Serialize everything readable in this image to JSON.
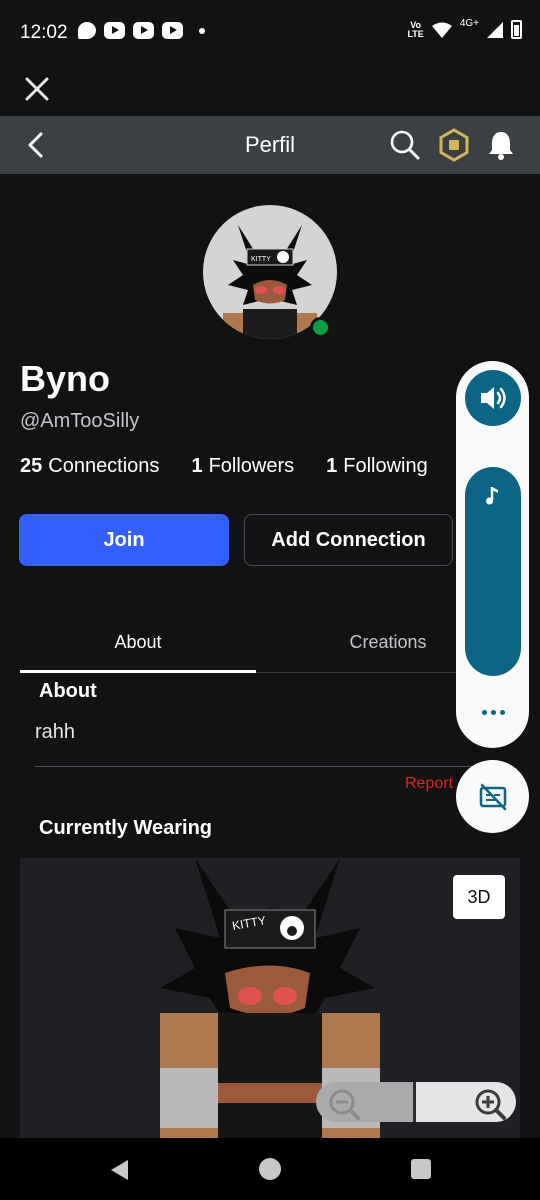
{
  "status_bar": {
    "time": "12:02",
    "volte": "Vo\nLTE",
    "network": "4G+"
  },
  "header": {
    "title": "Perfil"
  },
  "profile": {
    "display_name": "Byno",
    "username": "@AmTooSilly",
    "online": true,
    "hat_text": "KITTY",
    "stats": [
      {
        "count": "25",
        "label": "Connections"
      },
      {
        "count": "1",
        "label": "Followers"
      },
      {
        "count": "1",
        "label": "Following"
      }
    ]
  },
  "actions": {
    "join": "Join",
    "add_connection": "Add Connection"
  },
  "tabs": [
    {
      "label": "About",
      "active": true
    },
    {
      "label": "Creations",
      "active": false
    }
  ],
  "about": {
    "heading": "About",
    "text": "rahh",
    "report": "Report"
  },
  "wearing": {
    "heading": "Currently Wearing",
    "view_3d": "3D"
  },
  "colors": {
    "accent": "#335fff",
    "online": "#08a045",
    "report": "#e2231a",
    "music": "#0c6585"
  },
  "icons": {
    "close": "close-icon",
    "back": "chevron-left-icon",
    "search": "search-icon",
    "robux": "robux-icon",
    "bell": "bell-icon",
    "volume": "volume-icon",
    "music": "music-note-icon",
    "more": "more-dots-icon",
    "captions": "captions-off-icon",
    "zoom_out": "zoom-out-icon",
    "zoom_in": "zoom-in-icon"
  }
}
